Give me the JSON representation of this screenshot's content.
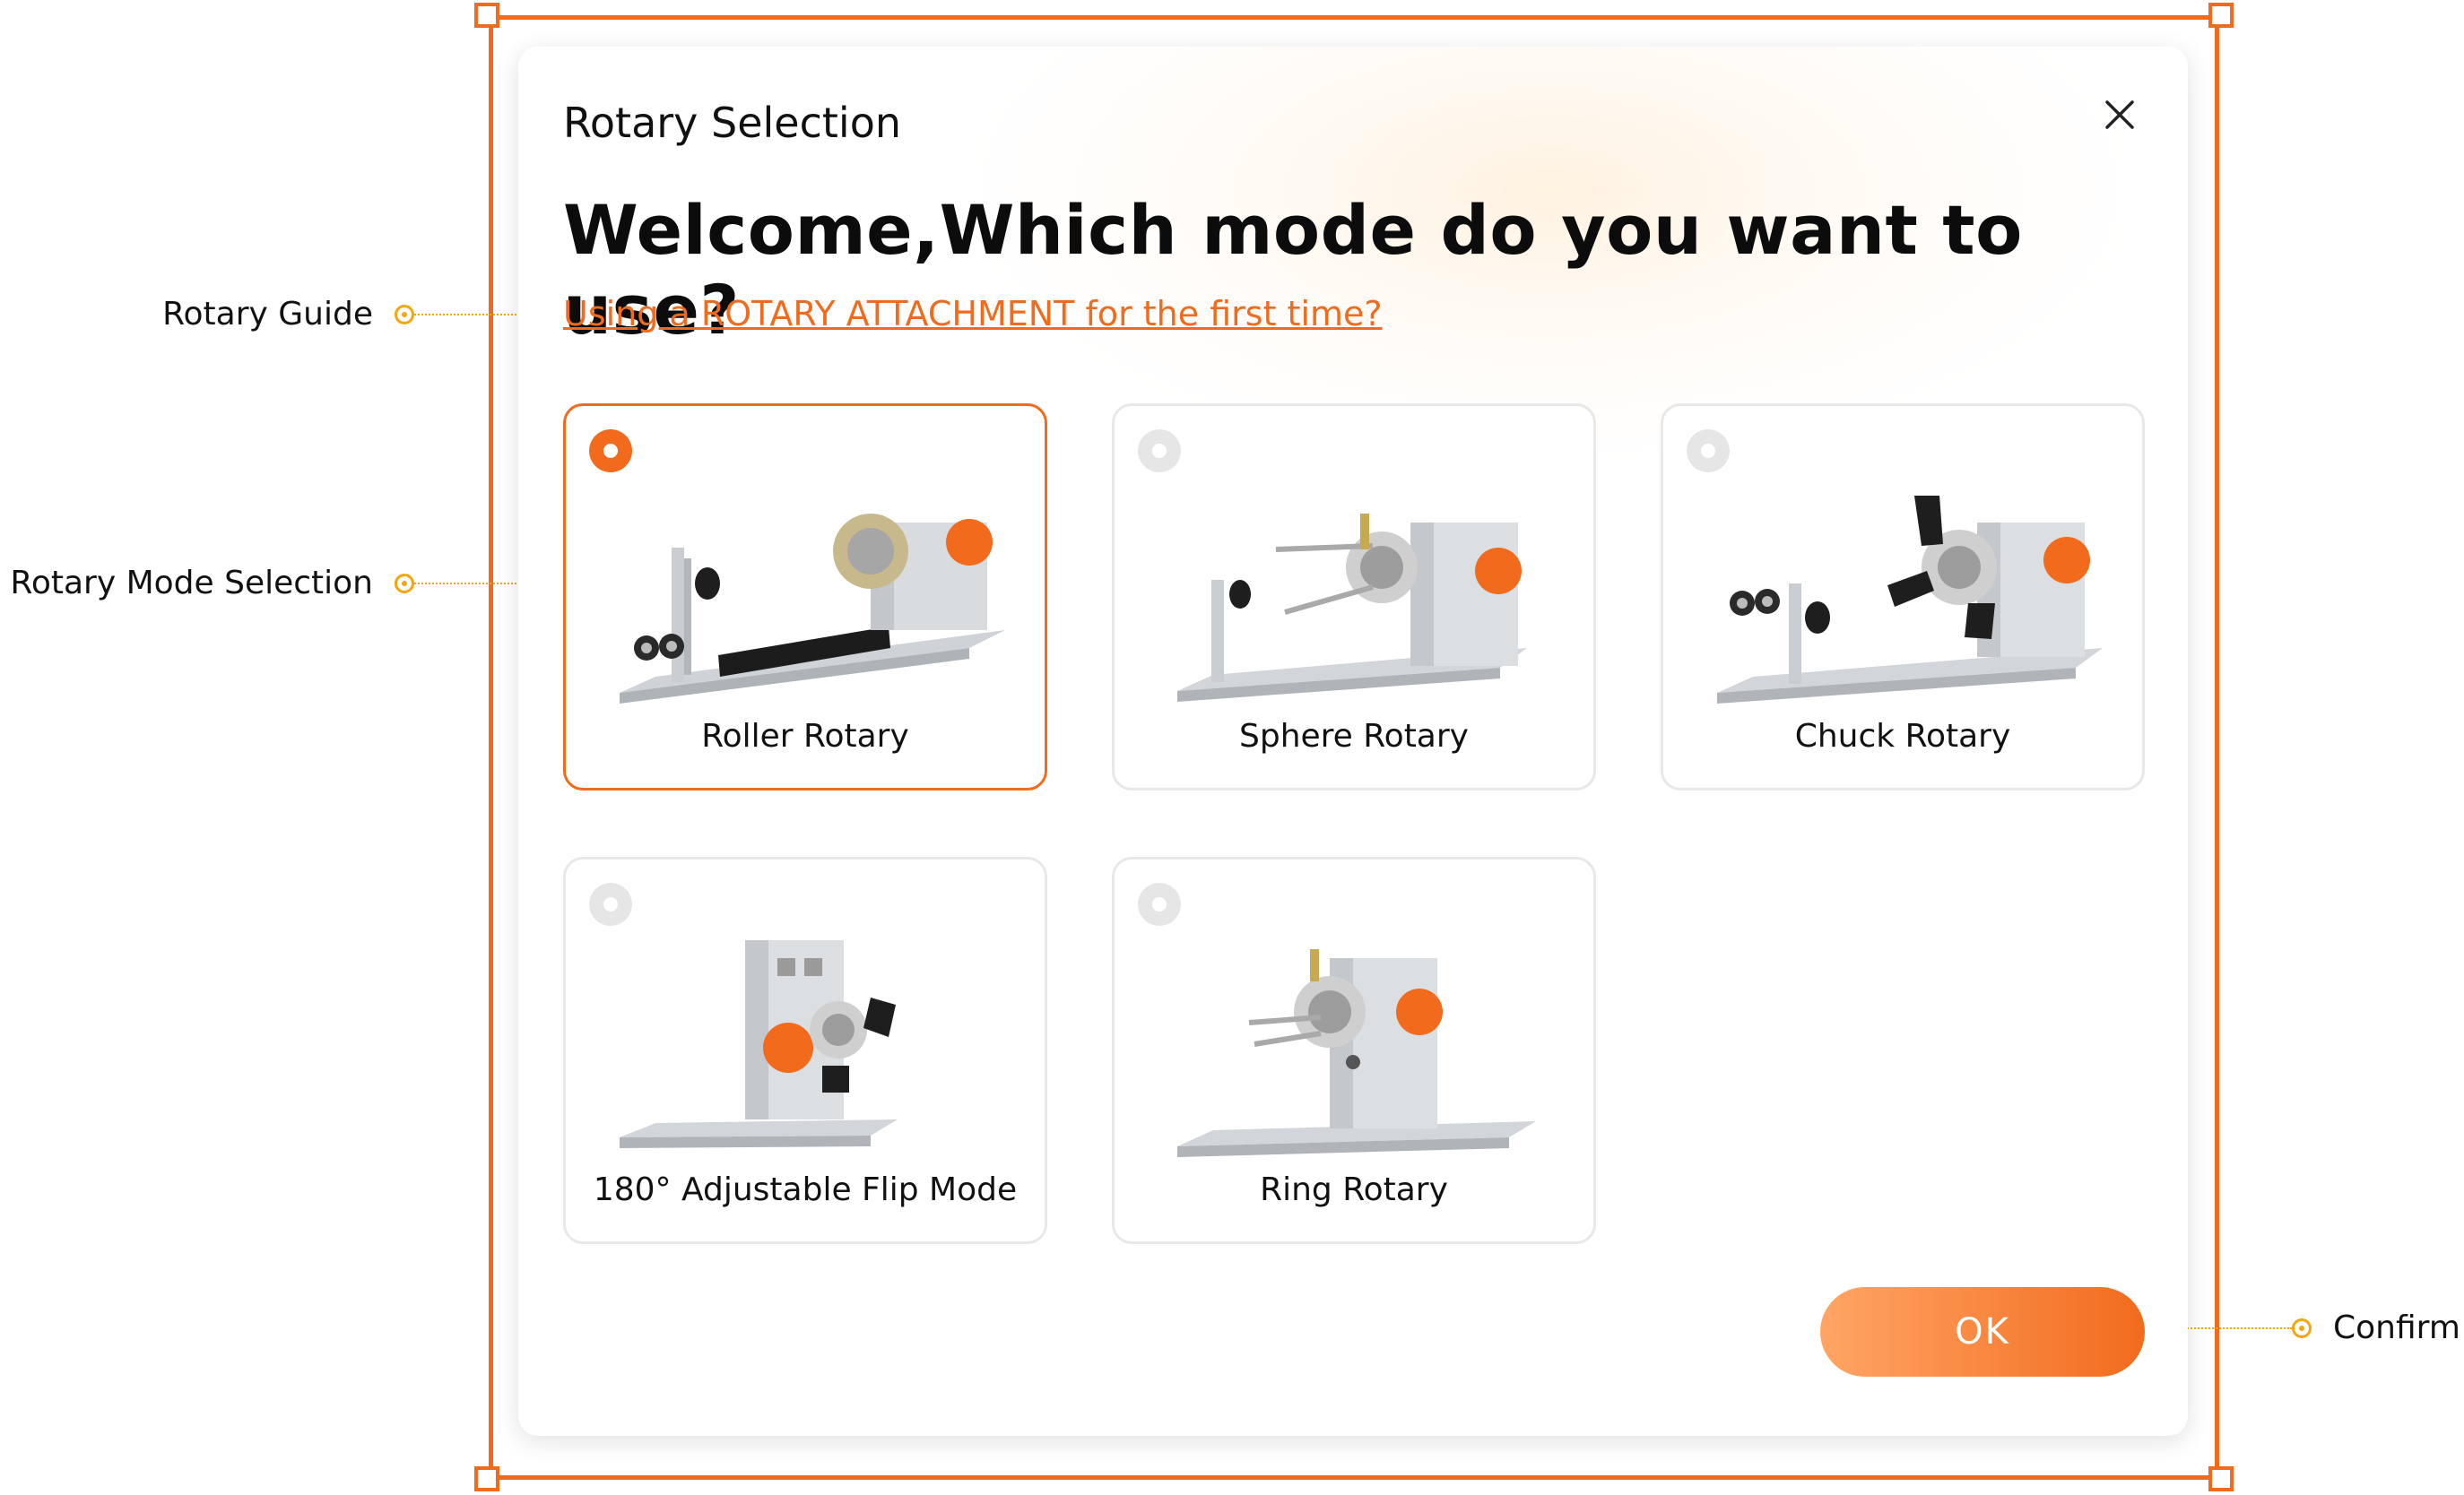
{
  "annotations": {
    "rotary_guide": "Rotary Guide",
    "rotary_mode_selection": "Rotary Mode Selection",
    "confirm": "Confirm"
  },
  "dialog": {
    "title": "Rotary Selection",
    "headline": "Welcome,Which mode do you want to use?",
    "guide_link": "Using a ROTARY ATTACHMENT for the first time?",
    "close_icon": "close-icon",
    "options": [
      {
        "label": "Roller Rotary",
        "selected": true,
        "icon": "roller-rotary-image"
      },
      {
        "label": "Sphere Rotary",
        "selected": false,
        "icon": "sphere-rotary-image"
      },
      {
        "label": "Chuck Rotary",
        "selected": false,
        "icon": "chuck-rotary-image"
      },
      {
        "label": "180° Adjustable Flip Mode",
        "selected": false,
        "icon": "flip-mode-image"
      },
      {
        "label": "Ring Rotary",
        "selected": false,
        "icon": "ring-rotary-image"
      }
    ],
    "ok_label": "OK"
  },
  "colors": {
    "accent": "#f26b1d",
    "annotation": "#f5a60c",
    "card_border": "#e8e8e8",
    "radio_off": "#e6e6e6"
  }
}
